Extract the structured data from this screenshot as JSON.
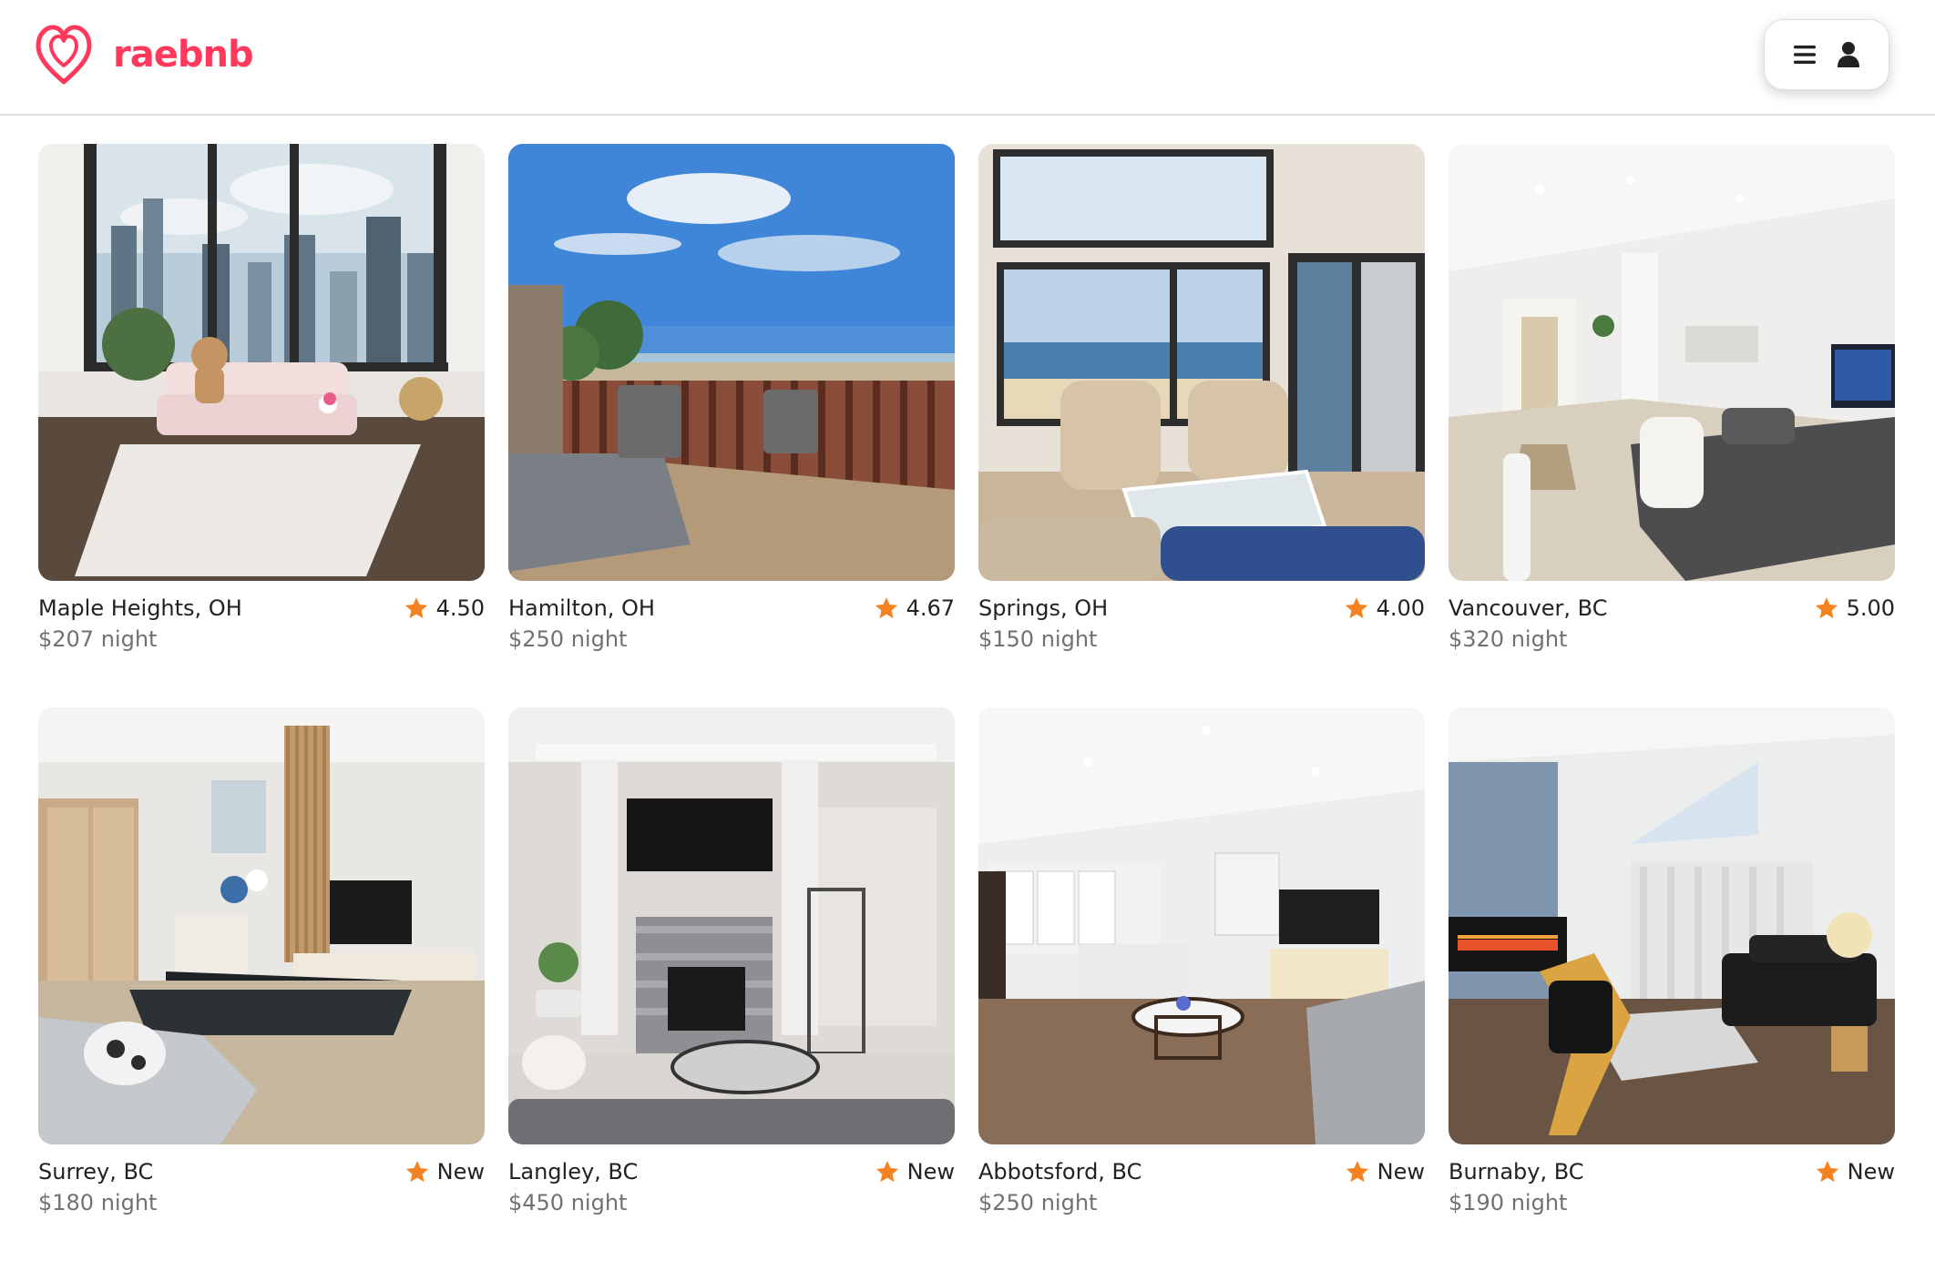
{
  "app": {
    "brand": "raebnb",
    "accent": "#ff385c",
    "star_color": "#f58220"
  },
  "header": {
    "logo_icon": "raebnb-logo-icon",
    "menu_icon": "hamburger-menu-icon",
    "profile_icon": "user-profile-icon"
  },
  "listings": [
    {
      "city": "Maple Heights, OH",
      "rating": "4.50",
      "price": "$207 night",
      "photo": "city-view-living-room"
    },
    {
      "city": "Hamilton, OH",
      "rating": "4.67",
      "price": "$250 night",
      "photo": "beach-deck-balcony"
    },
    {
      "city": "Springs, OH",
      "rating": "4.00",
      "price": "$150 night",
      "photo": "ocean-view-sitting-room"
    },
    {
      "city": "Vancouver, BC",
      "rating": "5.00",
      "price": "$320 night",
      "photo": "basement-living-room"
    },
    {
      "city": "Surrey, BC",
      "rating": "New",
      "price": "$180 night",
      "photo": "modern-living-room"
    },
    {
      "city": "Langley, BC",
      "rating": "New",
      "price": "$450 night",
      "photo": "fireplace-living-room"
    },
    {
      "city": "Abbotsford, BC",
      "rating": "New",
      "price": "$250 night",
      "photo": "open-kitchen-living-room"
    },
    {
      "city": "Burnaby, BC",
      "rating": "New",
      "price": "$190 night",
      "photo": "electric-fireplace-living-room"
    }
  ]
}
